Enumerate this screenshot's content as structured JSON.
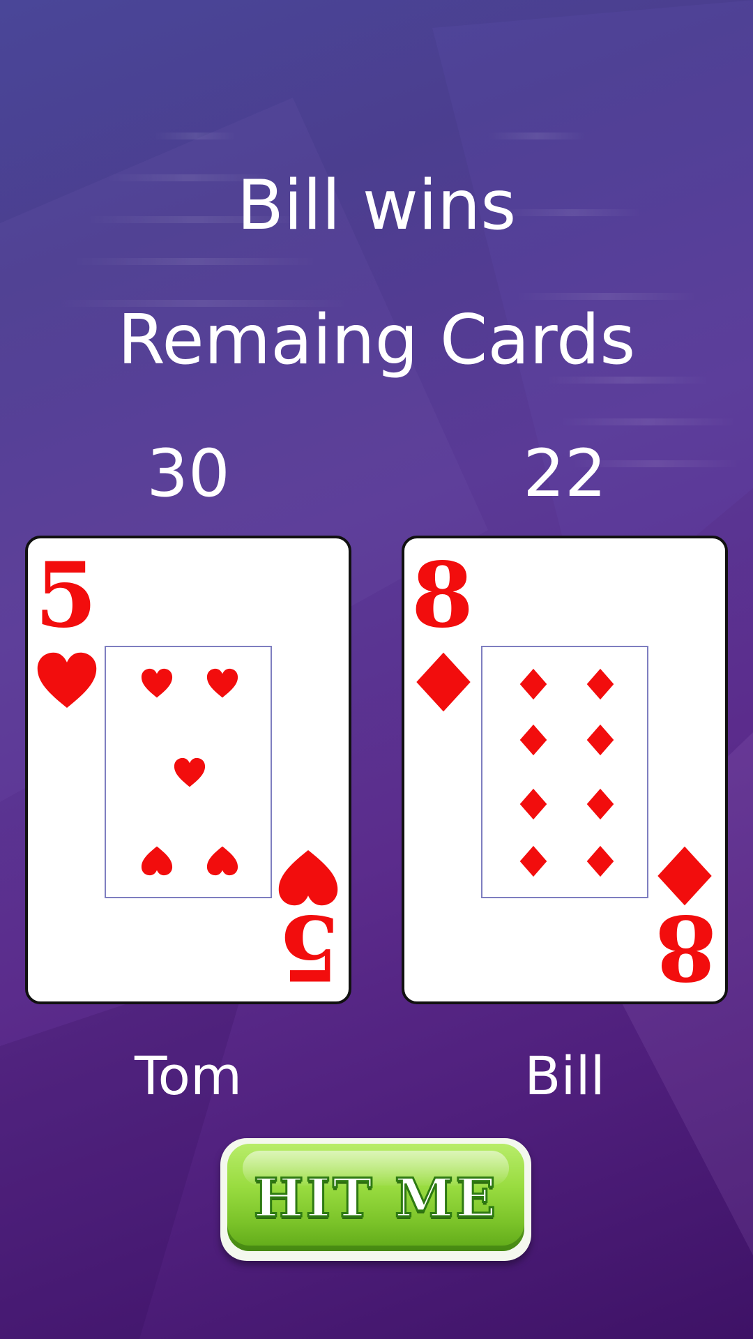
{
  "status": {
    "result": "Bill wins",
    "remaining_label": "Remaing Cards"
  },
  "players": [
    {
      "name": "Tom",
      "remaining": "30",
      "card": {
        "rank": "5",
        "suit": "hearts",
        "suit_icon": "heart-icon",
        "color": "#f20d0d"
      }
    },
    {
      "name": "Bill",
      "remaining": "22",
      "card": {
        "rank": "8",
        "suit": "diamonds",
        "suit_icon": "diamond-icon",
        "color": "#f20d0d"
      }
    }
  ],
  "actions": {
    "hit_label": "HIT ME"
  },
  "colors": {
    "text": "#ffffff",
    "card_red": "#f20d0d",
    "button_green": "#8fd43a"
  }
}
